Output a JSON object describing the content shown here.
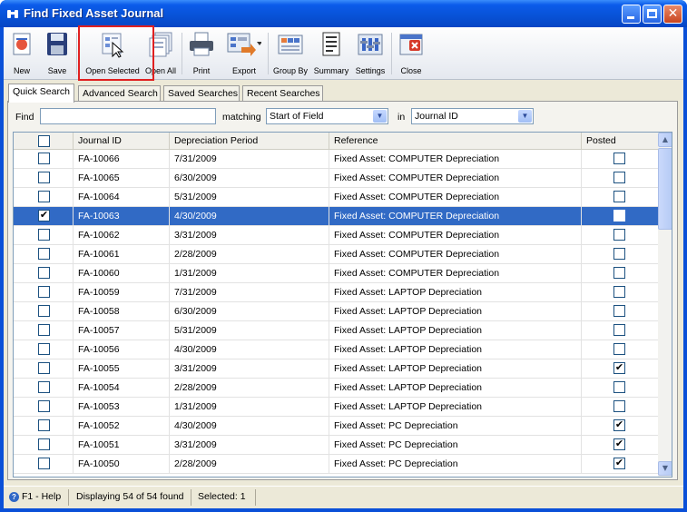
{
  "window": {
    "title": "Find Fixed Asset Journal",
    "buttons": [
      "minimize",
      "maximize",
      "close"
    ]
  },
  "toolbar": {
    "items": [
      {
        "label": "New",
        "icon": "new-document-icon"
      },
      {
        "label": "Save",
        "icon": "floppy-disk-icon"
      },
      {
        "label": "Open Selected",
        "icon": "open-selected-icon"
      },
      {
        "label": "Open All",
        "icon": "open-all-icon"
      },
      {
        "label": "Print",
        "icon": "printer-icon"
      },
      {
        "label": "Export",
        "icon": "export-icon"
      },
      {
        "label": "Group By",
        "icon": "group-by-icon"
      },
      {
        "label": "Summary",
        "icon": "summary-icon"
      },
      {
        "label": "Settings",
        "icon": "settings-icon"
      },
      {
        "label": "Close",
        "icon": "close-window-icon"
      }
    ]
  },
  "tabs": [
    "Quick Search",
    "Advanced Search",
    "Saved Searches",
    "Recent Searches"
  ],
  "find": {
    "find_label": "Find",
    "find_value": "",
    "matching_label": "matching",
    "matching_value": "Start of Field",
    "in_label": "in",
    "in_value": "Journal ID"
  },
  "grid": {
    "columns": [
      "",
      "Journal ID",
      "Depreciation Period",
      "Reference",
      "Posted"
    ],
    "rows": [
      {
        "checked": false,
        "id": "FA-10066",
        "period": "7/31/2009",
        "reference": "Fixed Asset: COMPUTER Depreciation",
        "posted": false,
        "selected": false
      },
      {
        "checked": false,
        "id": "FA-10065",
        "period": "6/30/2009",
        "reference": "Fixed Asset: COMPUTER Depreciation",
        "posted": false,
        "selected": false
      },
      {
        "checked": false,
        "id": "FA-10064",
        "period": "5/31/2009",
        "reference": "Fixed Asset: COMPUTER Depreciation",
        "posted": false,
        "selected": false
      },
      {
        "checked": true,
        "id": "FA-10063",
        "period": "4/30/2009",
        "reference": "Fixed Asset: COMPUTER Depreciation",
        "posted": false,
        "selected": true
      },
      {
        "checked": false,
        "id": "FA-10062",
        "period": "3/31/2009",
        "reference": "Fixed Asset: COMPUTER Depreciation",
        "posted": false,
        "selected": false
      },
      {
        "checked": false,
        "id": "FA-10061",
        "period": "2/28/2009",
        "reference": "Fixed Asset: COMPUTER Depreciation",
        "posted": false,
        "selected": false
      },
      {
        "checked": false,
        "id": "FA-10060",
        "period": "1/31/2009",
        "reference": "Fixed Asset: COMPUTER Depreciation",
        "posted": false,
        "selected": false
      },
      {
        "checked": false,
        "id": "FA-10059",
        "period": "7/31/2009",
        "reference": "Fixed Asset: LAPTOP Depreciation",
        "posted": false,
        "selected": false
      },
      {
        "checked": false,
        "id": "FA-10058",
        "period": "6/30/2009",
        "reference": "Fixed Asset: LAPTOP Depreciation",
        "posted": false,
        "selected": false
      },
      {
        "checked": false,
        "id": "FA-10057",
        "period": "5/31/2009",
        "reference": "Fixed Asset: LAPTOP Depreciation",
        "posted": false,
        "selected": false
      },
      {
        "checked": false,
        "id": "FA-10056",
        "period": "4/30/2009",
        "reference": "Fixed Asset: LAPTOP Depreciation",
        "posted": false,
        "selected": false
      },
      {
        "checked": false,
        "id": "FA-10055",
        "period": "3/31/2009",
        "reference": "Fixed Asset: LAPTOP Depreciation",
        "posted": true,
        "selected": false
      },
      {
        "checked": false,
        "id": "FA-10054",
        "period": "2/28/2009",
        "reference": "Fixed Asset: LAPTOP Depreciation",
        "posted": false,
        "selected": false
      },
      {
        "checked": false,
        "id": "FA-10053",
        "period": "1/31/2009",
        "reference": "Fixed Asset: LAPTOP Depreciation",
        "posted": false,
        "selected": false
      },
      {
        "checked": false,
        "id": "FA-10052",
        "period": "4/30/2009",
        "reference": "Fixed Asset: PC Depreciation",
        "posted": true,
        "selected": false
      },
      {
        "checked": false,
        "id": "FA-10051",
        "period": "3/31/2009",
        "reference": "Fixed Asset: PC Depreciation",
        "posted": true,
        "selected": false
      },
      {
        "checked": false,
        "id": "FA-10050",
        "period": "2/28/2009",
        "reference": "Fixed Asset: PC Depreciation",
        "posted": true,
        "selected": false
      }
    ]
  },
  "status": {
    "help": "F1 - Help",
    "displaying": "Displaying 54 of 54 found",
    "selected": "Selected: 1"
  },
  "colors": {
    "titlebar": "#0852d6",
    "selection": "#316ac5",
    "highlight_box": "#e02020"
  }
}
